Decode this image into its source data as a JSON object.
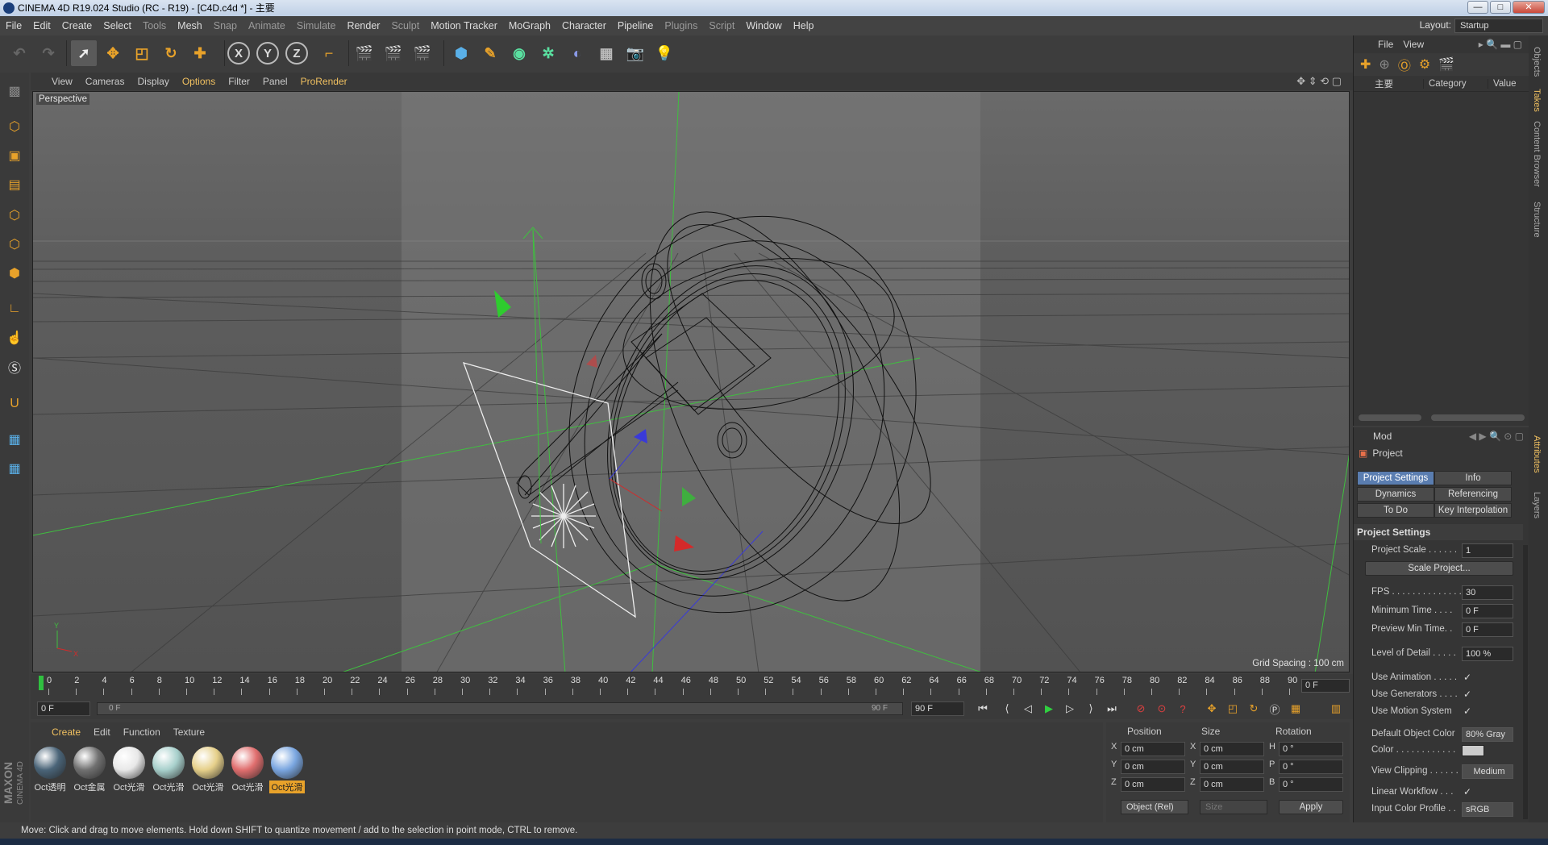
{
  "window": {
    "title": "CINEMA 4D R19.024 Studio (RC - R19) - [C4D.c4d *] - 主要",
    "minimize": "—",
    "maximize": "□",
    "close": "✕"
  },
  "menubar": {
    "items": [
      "File",
      "Edit",
      "Create",
      "Select",
      "Tools",
      "Mesh",
      "Snap",
      "Animate",
      "Simulate",
      "Render",
      "Sculpt",
      "Motion Tracker",
      "MoGraph",
      "Character",
      "Pipeline",
      "Plugins",
      "Script",
      "Window",
      "Help"
    ],
    "layout_label": "Layout:",
    "layout_value": "Startup"
  },
  "toolbar": {
    "axis_labels": [
      "X",
      "Y",
      "Z"
    ]
  },
  "viewport": {
    "menu": [
      "View",
      "Cameras",
      "Display",
      "Options",
      "Filter",
      "Panel",
      "ProRender"
    ],
    "camera_label": "Perspective",
    "grid_spacing": "Grid Spacing : 100 cm",
    "axis_x": "X",
    "axis_y": "Y"
  },
  "timeline": {
    "ticks": [
      "0",
      "2",
      "4",
      "6",
      "8",
      "10",
      "12",
      "14",
      "16",
      "18",
      "20",
      "22",
      "24",
      "26",
      "28",
      "30",
      "32",
      "34",
      "36",
      "38",
      "40",
      "42",
      "44",
      "46",
      "48",
      "50",
      "52",
      "54",
      "56",
      "58",
      "60",
      "62",
      "64",
      "66",
      "68",
      "70",
      "72",
      "74",
      "76",
      "78",
      "80",
      "82",
      "84",
      "86",
      "88",
      "90"
    ],
    "current_frame": "0 F"
  },
  "transport": {
    "start_frame": "0 F",
    "range_start": "0 F",
    "range_end": "90 F",
    "end_frame": "90 F"
  },
  "materials": {
    "menu": [
      "Create",
      "Edit",
      "Function",
      "Texture"
    ],
    "items": [
      {
        "label": "Oct透明",
        "color": "#4a6478"
      },
      {
        "label": "Oct金属",
        "color": "#707070"
      },
      {
        "label": "Oct光滑",
        "color": "#e8e8e8"
      },
      {
        "label": "Oct光滑",
        "color": "#a8d0cc"
      },
      {
        "label": "Oct光滑",
        "color": "#e6d08a"
      },
      {
        "label": "Oct光滑",
        "color": "#e06e6e"
      },
      {
        "label": "Oct光滑",
        "color": "#7aa6e0"
      }
    ],
    "brand_top": "MAXON",
    "brand_bottom": "CINEMA 4D"
  },
  "coordinates": {
    "headers": [
      "Position",
      "Size",
      "Rotation"
    ],
    "rows": [
      {
        "p_label": "X",
        "p_val": "0 cm",
        "s_label": "X",
        "s_val": "0 cm",
        "r_label": "H",
        "r_val": "0 °"
      },
      {
        "p_label": "Y",
        "p_val": "0 cm",
        "s_label": "Y",
        "s_val": "0 cm",
        "r_label": "P",
        "r_val": "0 °"
      },
      {
        "p_label": "Z",
        "p_val": "0 cm",
        "s_label": "Z",
        "s_val": "0 cm",
        "r_label": "B",
        "r_val": "0 °"
      }
    ],
    "mode": "Object (Rel)",
    "size_mode": "Size",
    "apply": "Apply"
  },
  "object_manager": {
    "menu": [
      "File",
      "View"
    ],
    "col_name": "主要",
    "col_category": "Category",
    "col_value": "Value"
  },
  "attributes": {
    "menu": "Mod",
    "object": "Project",
    "tabs": [
      "Project Settings",
      "Info",
      "Dynamics",
      "Referencing",
      "To Do",
      "Key Interpolation"
    ],
    "section": "Project Settings",
    "fields": {
      "project_scale": {
        "label": "Project Scale . . . . . .",
        "value": "1"
      },
      "scale_project": "Scale Project...",
      "fps": {
        "label": "FPS . . . . . . . . . . . . . .",
        "value": "30"
      },
      "min_time": {
        "label": "Minimum Time . . . .",
        "value": "0 F"
      },
      "preview_min": {
        "label": "Preview Min Time. .",
        "value": "0 F"
      },
      "lod": {
        "label": "Level of Detail . . . . .",
        "value": "100 %"
      },
      "use_animation": {
        "label": "Use Animation . . . . .",
        "value": "✓"
      },
      "use_generators": {
        "label": "Use Generators . . . .",
        "value": "✓"
      },
      "use_motion": {
        "label": "Use Motion System",
        "value": "✓"
      },
      "default_color": {
        "label": "Default Object Color",
        "value": "80% Gray"
      },
      "color": {
        "label": "Color . . . . . . . . . . . ."
      },
      "view_clipping": {
        "label": "View Clipping . . . . . .",
        "value": "Medium"
      },
      "linear_workflow": {
        "label": "Linear Workflow . . .",
        "value": "✓"
      },
      "input_color": {
        "label": "Input Color Profile . .",
        "value": "sRGB"
      }
    }
  },
  "side_tabs": [
    "Objects",
    "Takes",
    "Content Browser",
    "Structure",
    "Attributes",
    "Layers"
  ],
  "status": "Move: Click and drag to move elements. Hold down SHIFT to quantize movement / add to the selection in point mode, CTRL to remove."
}
